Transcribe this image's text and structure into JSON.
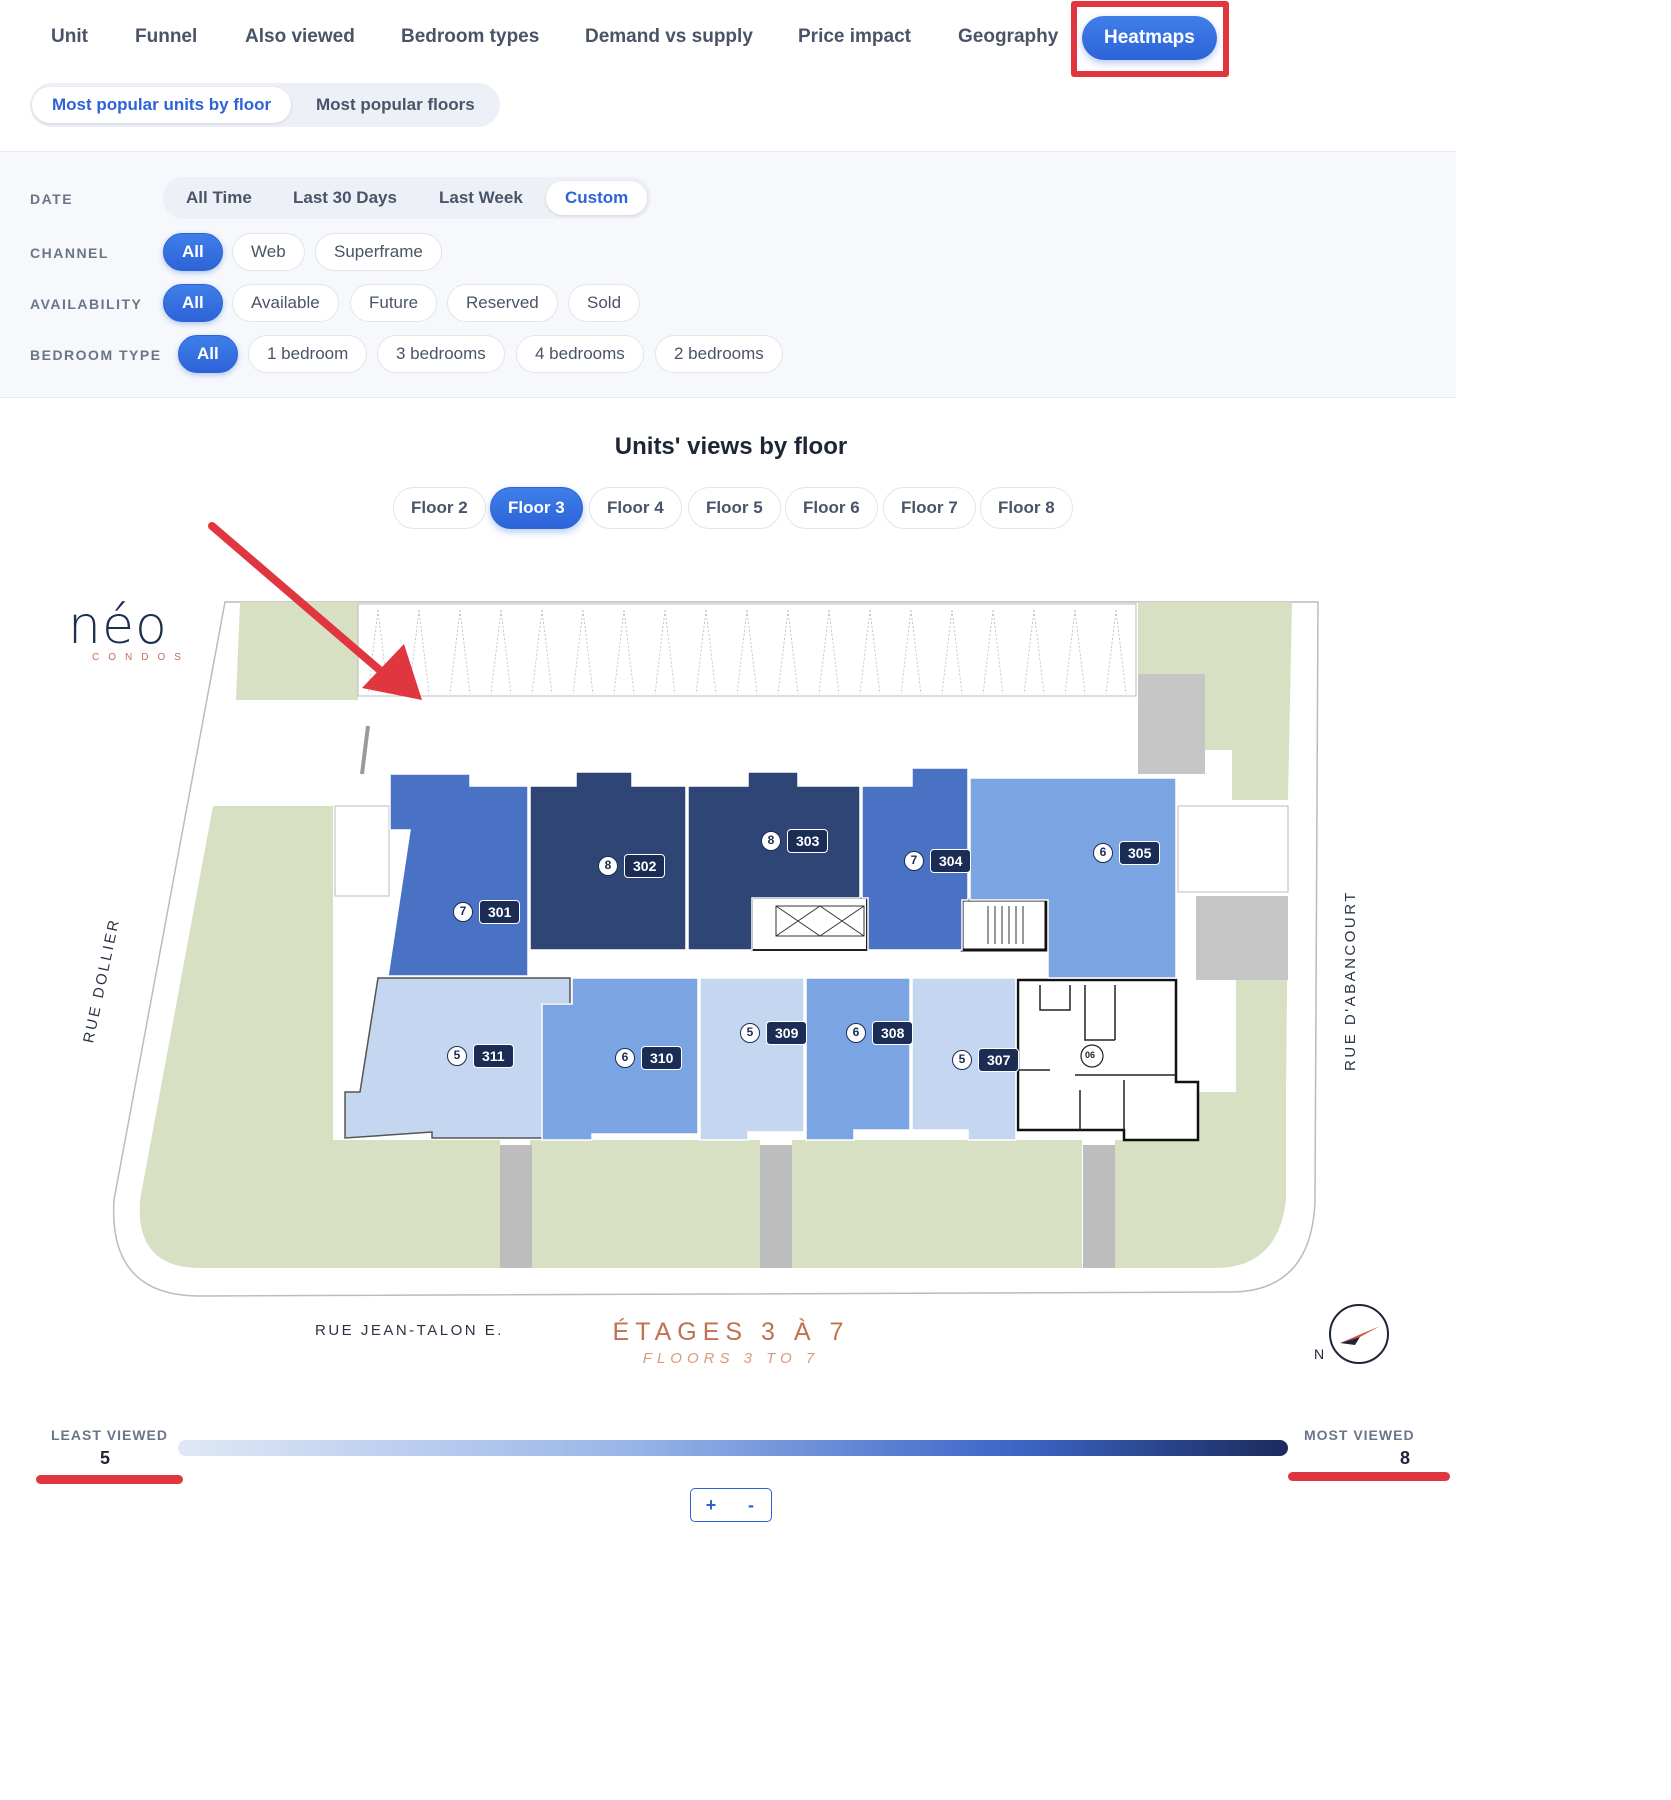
{
  "nav": {
    "tabs": [
      "Unit",
      "Funnel",
      "Also viewed",
      "Bedroom types",
      "Demand vs supply",
      "Price impact",
      "Geography",
      "Heatmaps"
    ],
    "active": "Heatmaps"
  },
  "subtabs": [
    "Most popular units by floor",
    "Most popular floors"
  ],
  "filters": {
    "date": {
      "label": "DATE",
      "options": [
        "All Time",
        "Last 30 Days",
        "Last Week",
        "Custom"
      ],
      "selected": "Custom"
    },
    "channel": {
      "label": "CHANNEL",
      "options": [
        "All",
        "Web",
        "Superframe"
      ],
      "selected": "All"
    },
    "availability": {
      "label": "AVAILABILITY",
      "options": [
        "All",
        "Available",
        "Future",
        "Reserved",
        "Sold"
      ],
      "selected": "All"
    },
    "bedroom": {
      "label": "BEDROOM TYPE",
      "options": [
        "All",
        "1 bedroom",
        "3 bedrooms",
        "4 bedrooms",
        "2 bedrooms"
      ],
      "selected": "All"
    }
  },
  "heatmap": {
    "title": "Units' views by floor",
    "floors": [
      "Floor 2",
      "Floor 3",
      "Floor 4",
      "Floor 5",
      "Floor 6",
      "Floor 7",
      "Floor 8"
    ],
    "selected_floor": "Floor 3",
    "units": [
      {
        "unit": "301",
        "views": 7
      },
      {
        "unit": "302",
        "views": 8
      },
      {
        "unit": "303",
        "views": 8
      },
      {
        "unit": "304",
        "views": 7
      },
      {
        "unit": "305",
        "views": 6
      },
      {
        "unit": "311",
        "views": 5
      },
      {
        "unit": "310",
        "views": 6
      },
      {
        "unit": "309",
        "views": 5
      },
      {
        "unit": "308",
        "views": 6
      },
      {
        "unit": "307",
        "views": 5
      }
    ],
    "plan_labels": {
      "logo": "néo",
      "logo_sub": "CONDOS",
      "street_west": "RUE DOLLIER",
      "street_east": "RUE D'ABANCOURT",
      "street_south": "RUE JEAN-TALON E.",
      "floors_fr": "ÉTAGES 3 À 7",
      "floors_en": "FLOORS 3 TO 7",
      "unit_06": "06",
      "compass": "N"
    },
    "legend": {
      "least_label": "LEAST VIEWED",
      "least_value": "5",
      "most_label": "MOST VIEWED",
      "most_value": "8"
    },
    "zoom": {
      "in": "+",
      "out": "-"
    }
  },
  "colors": {
    "accent": "#2d63d8",
    "highlight": "#e0363f",
    "grass": "#d7e0c2",
    "views_5": "#c5d6f0",
    "views_6": "#7ba4e3",
    "views_7": "#4a72c4",
    "views_8": "#2f4575"
  }
}
